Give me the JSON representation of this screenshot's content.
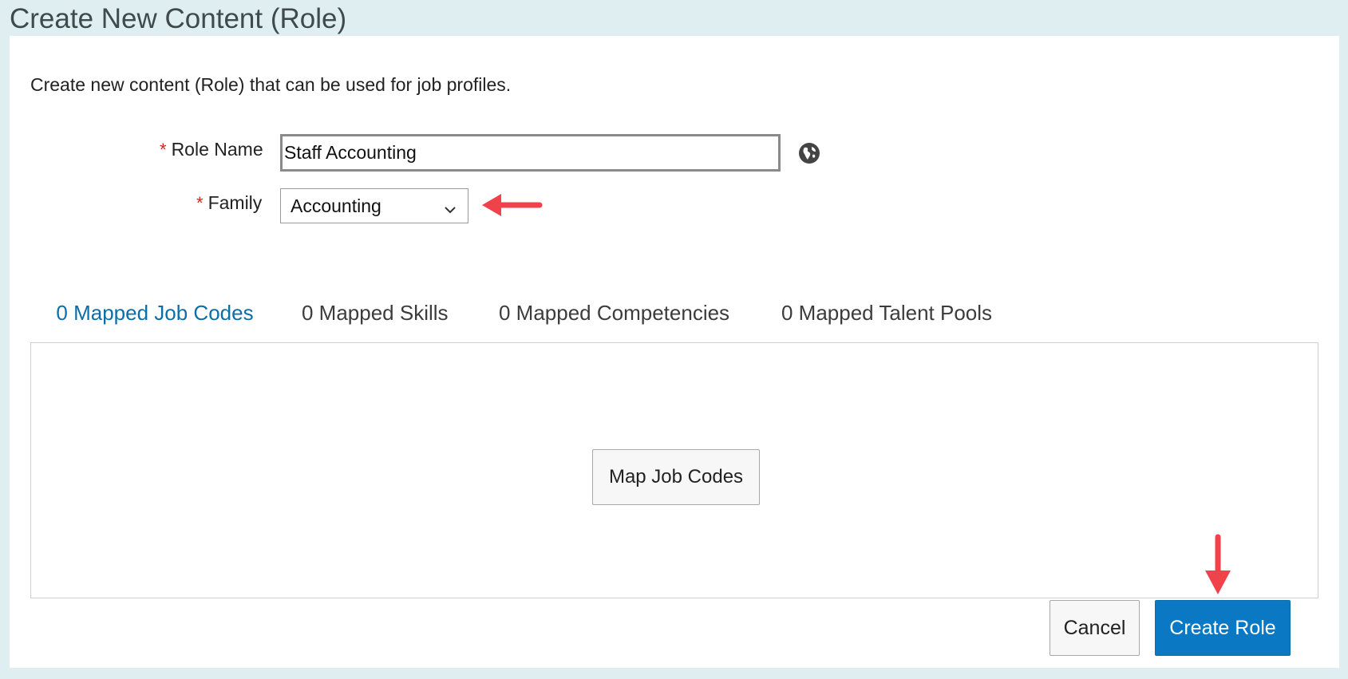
{
  "dialog": {
    "title": "Create New Content (Role)",
    "intro": "Create new content (Role) that can be used for job profiles."
  },
  "form": {
    "required_marker": "*",
    "role_name": {
      "label": "Role Name",
      "value": "Staff Accounting"
    },
    "family": {
      "label": "Family",
      "selected": "Accounting"
    }
  },
  "tabs": [
    {
      "label": "0 Mapped Job Codes",
      "active": true
    },
    {
      "label": "0 Mapped Skills",
      "active": false
    },
    {
      "label": "0 Mapped Competencies",
      "active": false
    },
    {
      "label": "0 Mapped Talent Pools",
      "active": false
    }
  ],
  "tab_panel": {
    "action_label": "Map Job Codes"
  },
  "footer": {
    "cancel_label": "Cancel",
    "create_label": "Create Role"
  },
  "colors": {
    "accent": "#0a78c2",
    "active_tab": "#0a6fa8",
    "required": "#d0271d",
    "annotation_arrow": "#f0424a",
    "background": "#dfeff1"
  },
  "icons": {
    "translate": "globe-icon",
    "dropdown": "chevron-down-icon",
    "annotation": "red-arrow-icon"
  }
}
